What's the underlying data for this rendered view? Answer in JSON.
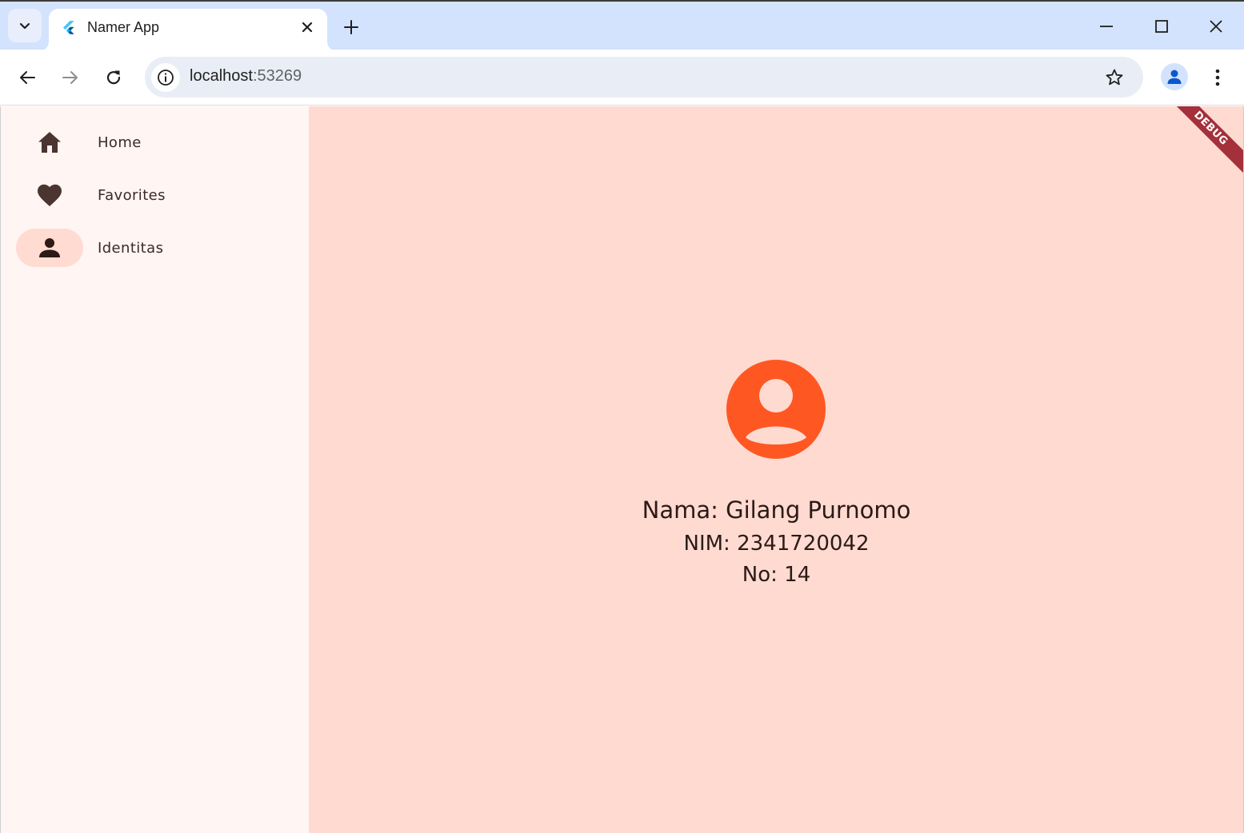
{
  "browser": {
    "tab_title": "Namer App",
    "url_host": "localhost",
    "url_port": ":53269",
    "icons": {
      "tab_search": "chevron-down-icon",
      "favicon": "flutter-icon",
      "close_tab": "close-icon",
      "new_tab": "plus-icon",
      "minimize": "minimize-icon",
      "maximize": "maximize-icon",
      "close_window": "close-icon",
      "back": "arrow-left-icon",
      "forward": "arrow-right-icon",
      "reload": "reload-icon",
      "site_info": "info-icon",
      "bookmark": "star-icon",
      "profile": "person-icon",
      "menu": "more-vert-icon"
    }
  },
  "nav": {
    "items": [
      {
        "label": "Home",
        "icon": "home-icon",
        "selected": false
      },
      {
        "label": "Favorites",
        "icon": "heart-icon",
        "selected": false
      },
      {
        "label": "Identitas",
        "icon": "person-icon",
        "selected": true
      }
    ]
  },
  "content": {
    "debug_banner": "DEBUG",
    "avatar_icon": "account-circle-icon",
    "name_line": "Nama: Gilang Purnomo",
    "nim_line": "NIM: 2341720042",
    "no_line": "No: 14"
  },
  "colors": {
    "accent": "#ff5722",
    "content_bg": "#ffdad1",
    "rail_bg": "#fff5f3",
    "indicator": "#ffdbd1",
    "tabstrip": "#d3e3fd",
    "debug": "#a3303a"
  }
}
